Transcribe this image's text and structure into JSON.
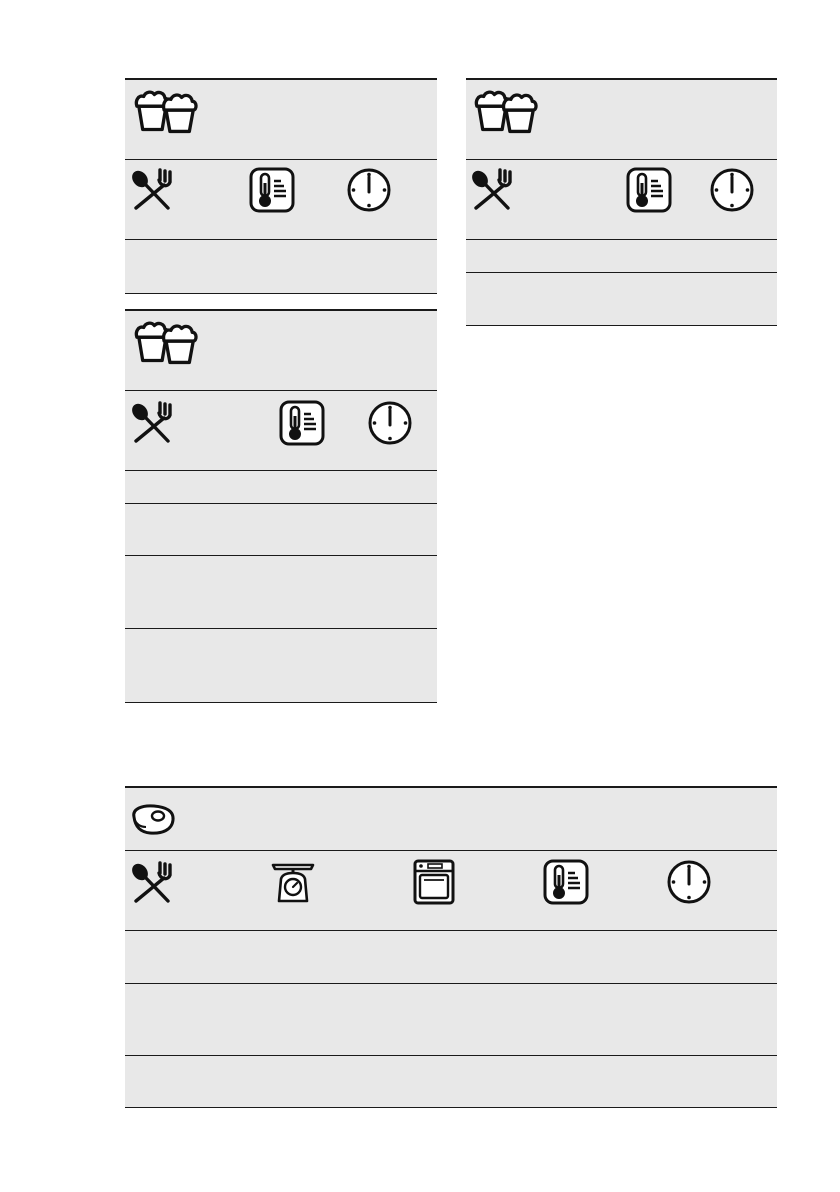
{
  "page": {
    "background": "#ffffff",
    "table_fill": "#e8e8e8",
    "rule_color": "#1a1a1a"
  },
  "tables": [
    {
      "name": "baking-table-1",
      "header_icon": "muffins-icon",
      "column_icons": [
        "spoon-fork-icon",
        "thermometer-icon",
        "clock-icon"
      ],
      "rows": [
        [
          "",
          "",
          ""
        ]
      ]
    },
    {
      "name": "baking-table-2",
      "header_icon": "muffins-icon",
      "column_icons": [
        "spoon-fork-icon",
        "thermometer-icon",
        "clock-icon"
      ],
      "rows": [
        [
          "",
          "",
          ""
        ],
        [
          "",
          "",
          ""
        ],
        [
          "",
          "",
          ""
        ],
        [
          "",
          "",
          ""
        ]
      ]
    },
    {
      "name": "baking-table-3",
      "header_icon": "muffins-icon",
      "column_icons": [
        "spoon-fork-icon",
        "thermometer-icon",
        "clock-icon"
      ],
      "rows": [
        [
          "",
          "",
          ""
        ],
        [
          "",
          "",
          ""
        ]
      ]
    },
    {
      "name": "roasting-table",
      "header_icon": "meat-steak-icon",
      "column_icons": [
        "spoon-fork-icon",
        "kitchen-scale-icon",
        "oven-icon",
        "thermometer-icon",
        "clock-icon"
      ],
      "rows": [
        [
          "",
          "",
          "",
          "",
          ""
        ],
        [
          "",
          "",
          "",
          "",
          ""
        ],
        [
          "",
          "",
          "",
          "",
          ""
        ]
      ]
    }
  ]
}
